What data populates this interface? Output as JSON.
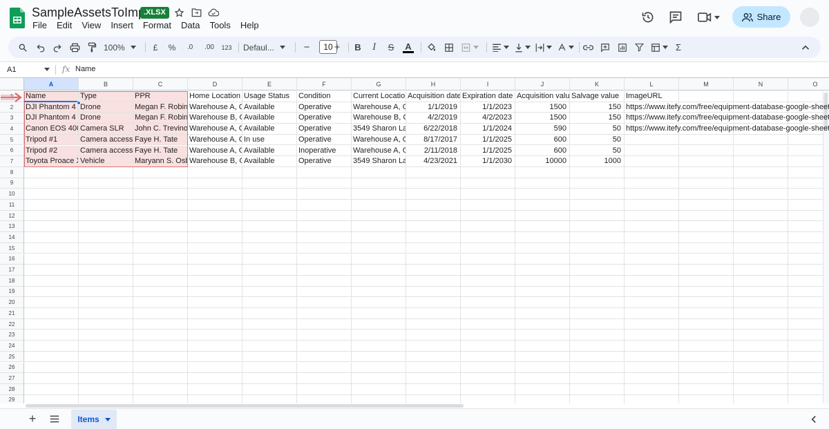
{
  "header": {
    "title": "SampleAssetsToImport",
    "badge": ".XLSX",
    "menu": [
      "File",
      "Edit",
      "View",
      "Insert",
      "Format",
      "Data",
      "Tools",
      "Help"
    ],
    "share_label": "Share"
  },
  "toolbar": {
    "zoom": "100%",
    "currency": "£",
    "percent": "%",
    "decimal_decrease": ".0",
    "decimal_increase": ".00",
    "number_format": "123",
    "font": "Defaul...",
    "font_size": "10",
    "minus": "−",
    "plus": "+",
    "bold": "B",
    "italic": "I",
    "strike": "S",
    "text_color": "A",
    "sigma": "Σ"
  },
  "formula_bar": {
    "cell_ref": "A1",
    "fx": "fx",
    "value": "Name"
  },
  "columns": [
    "A",
    "B",
    "C",
    "D",
    "E",
    "F",
    "G",
    "H",
    "I",
    "J",
    "K",
    "L",
    "M",
    "N",
    "O"
  ],
  "headers_row": [
    "Name",
    "Type",
    "PPR",
    "Home Location",
    "Usage Status",
    "Condition",
    "Current Location",
    "Acquisition date",
    "Expiration date",
    "Acquisition value",
    "Salvage value",
    "ImageURL"
  ],
  "rows": [
    [
      "DJI Phantom 4 #",
      "Drone",
      "Megan F. Robins",
      "Warehouse A, O",
      "Available",
      "Operative",
      "Warehouse A, O",
      "1/1/2019",
      "1/1/2023",
      "1500",
      "150",
      "https://www.itefy.com/free/equipment-database-google-sheets"
    ],
    [
      "DJI Phantom 4 #",
      "Drone",
      "Megan F. Robins",
      "Warehouse B, O",
      "Available",
      "Operative",
      "Warehouse B, O",
      "4/2/2019",
      "4/2/2023",
      "1500",
      "150",
      "https://www.itefy.com/free/equipment-database-google-sheets"
    ],
    [
      "Canon EOS 400",
      "Camera SLR",
      "John C. Trevino",
      "Warehouse A, O",
      "Available",
      "Operative",
      "3549 Sharon Lai",
      "6/22/2018",
      "1/1/2024",
      "590",
      "50",
      "https://www.itefy.com/free/equipment-database-google-sheets"
    ],
    [
      "Tripod #1",
      "Camera accesso",
      "Faye H. Tate",
      "Warehouse A, O",
      "In use",
      "Operative",
      "Warehouse A, O",
      "8/17/2017",
      "1/1/2025",
      "600",
      "50",
      ""
    ],
    [
      "Tripod #2",
      "Camera accesso",
      "Faye H. Tate",
      "Warehouse A, O",
      "Available",
      "Inoperative",
      "Warehouse A, O",
      "2/11/2018",
      "1/1/2025",
      "600",
      "50",
      ""
    ],
    [
      "Toyota Proace X",
      "Vehicle",
      "Maryann S. Osb",
      "Warehouse B, O",
      "Available",
      "Operative",
      "3549 Sharon Lai",
      "4/23/2021",
      "1/1/2030",
      "10000",
      "1000",
      ""
    ]
  ],
  "row_numbers": [
    "1",
    "2",
    "3",
    "4",
    "5",
    "6",
    "7",
    "8",
    "9",
    "10",
    "11",
    "12",
    "13",
    "14",
    "15",
    "16",
    "17",
    "18",
    "19",
    "20",
    "21",
    "22",
    "23",
    "24",
    "25",
    "26",
    "27",
    "28",
    "29"
  ],
  "sheet_tab": "Items",
  "colors": {
    "badge_green": "#188038",
    "share_bg": "#c2e7ff",
    "highlight_fill": "#f9e1e1",
    "highlight_border": "#e07070",
    "selection_blue": "#1a73e8"
  }
}
